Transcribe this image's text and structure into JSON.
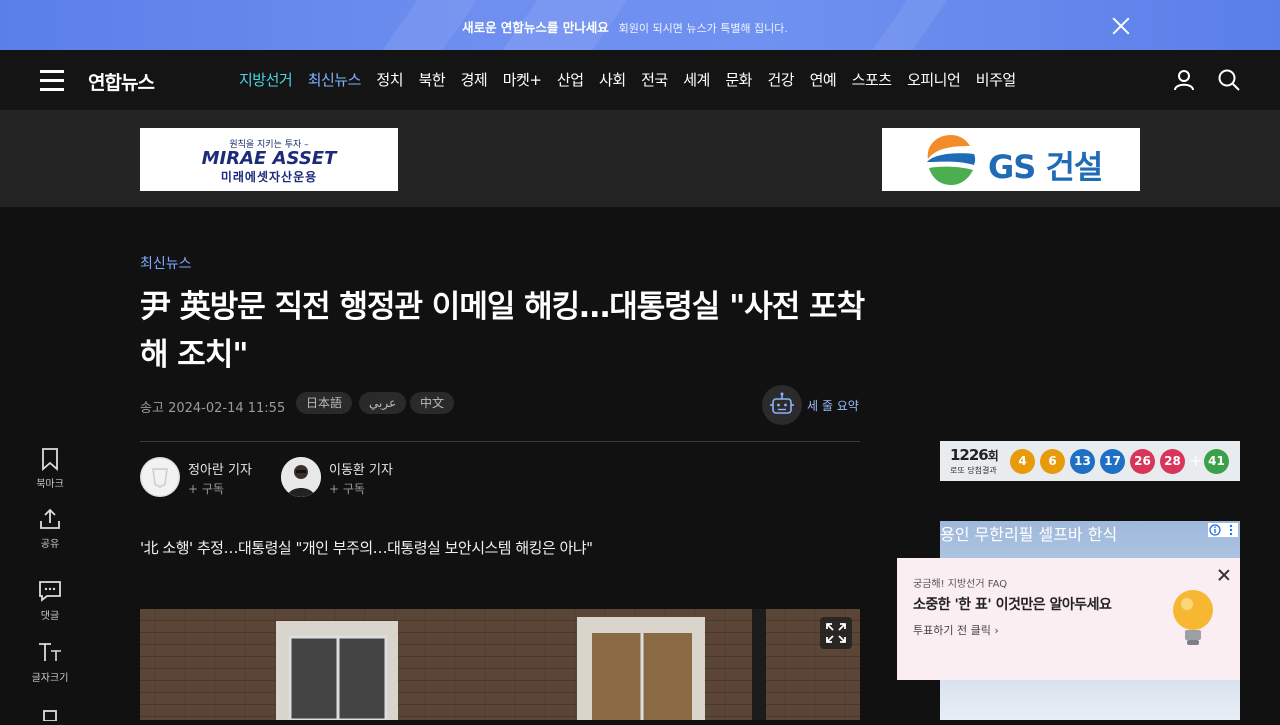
{
  "banner": {
    "title": "새로운 연합뉴스를 만나세요",
    "subtitle": "회원이 되시면 뉴스가 특별해 집니다."
  },
  "nav": {
    "logo": "연합뉴스",
    "menu": [
      "지방선거",
      "최신뉴스",
      "정치",
      "북한",
      "경제",
      "마켓+",
      "산업",
      "사회",
      "전국",
      "세계",
      "문화",
      "건강",
      "연예",
      "스포츠",
      "오피니언",
      "비주얼"
    ]
  },
  "ads": {
    "mirae_small": "원칙을 지키는 투자 –",
    "mirae_brand": "MIRAE ASSET",
    "mirae_kr": "미래에셋자산운용",
    "gs": "GS 건설"
  },
  "article": {
    "category": "최신뉴스",
    "title": "尹 英방문 직전 행정관 이메일 해킹…대통령실 \"사전 포착해 조치\"",
    "sent_label": "송고",
    "sent_time": "2024-02-14 11:55",
    "languages": [
      "日本語",
      "عربي",
      "中文"
    ],
    "summary_label": "세 줄 요약",
    "reporters": [
      {
        "name": "정아란 기자",
        "subscribe": "+ 구독"
      },
      {
        "name": "이동환 기자",
        "subscribe": "+ 구독"
      }
    ],
    "lede": "'北 소행' 추정…대통령실 \"개인 부주의…대통령실 보안시스템 해킹은 아냐\""
  },
  "side_tools": {
    "bookmark": "북마크",
    "share": "공유",
    "comment": "댓글",
    "font": "글자크기"
  },
  "lotto": {
    "round": "1226",
    "round_unit": "회",
    "result_label": "로또 당첨결과",
    "numbers": [
      4,
      6,
      13,
      17,
      26,
      28
    ],
    "bonus": 41,
    "colors": [
      "#e89b0a",
      "#e89b0a",
      "#1f6fc4",
      "#1f6fc4",
      "#d9345a",
      "#d9345a",
      "#3aa14a"
    ]
  },
  "faq": {
    "kicker": "궁금해! 지방선거 FAQ",
    "title": "소중한 '한 표' 이것만은 알아두세요",
    "link": "투표하기 전 클릭"
  },
  "ad_right": {
    "caption": "용인 무한리필 셀프바 한식"
  }
}
